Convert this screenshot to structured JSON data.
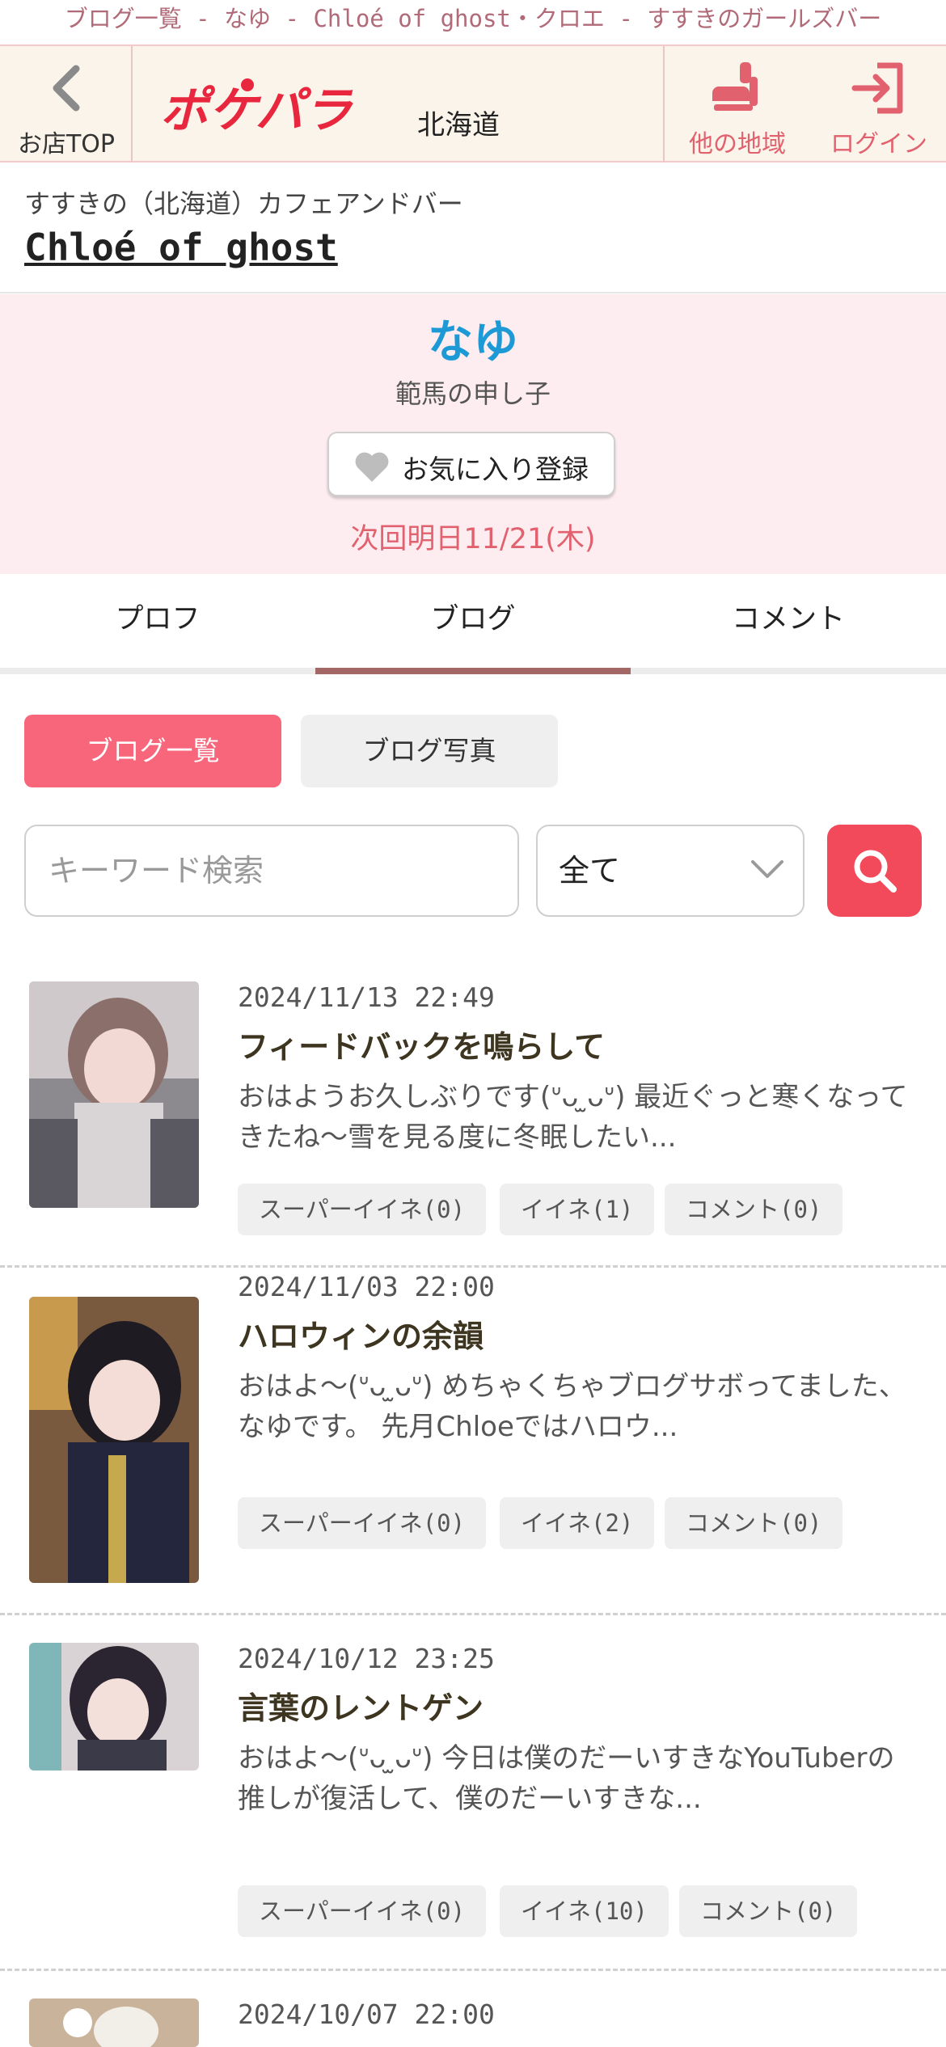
{
  "page": {
    "caption": "ブログ一覧 - なゆ - Chloé of ghost・クロエ - すすきのガールズバー"
  },
  "header": {
    "back_label": "お店TOP",
    "logo_text": "ポケパラ",
    "region": "北海道",
    "region_button_label": "他の地域",
    "login_label": "ログイン",
    "accent_color": "#e2616e"
  },
  "shop": {
    "subtitle": "すすきの（北海道）カフェアンドバー",
    "name": "Chloé of ghost"
  },
  "profile": {
    "name": "なゆ",
    "tagline": "範馬の申し子",
    "favorite_label": "お気に入り登録",
    "next_shift": "次回明日11/21(木)"
  },
  "tabs": [
    {
      "label": "プロフ",
      "active": false
    },
    {
      "label": "ブログ",
      "active": true
    },
    {
      "label": "コメント",
      "active": false
    }
  ],
  "blog_nav": {
    "list_label": "ブログ一覧",
    "photos_label": "ブログ写真"
  },
  "search": {
    "placeholder": "キーワード検索",
    "filter_value": "全て"
  },
  "posts": [
    {
      "date": "2024/11/13 22:49",
      "title": "フィードバックを鳴らして",
      "excerpt": "おはようお久しぶりです(ᐡᴗ ̫ᴗᐡ) 最近ぐっと寒くなってきたね〜雪を見る度に冬眠したい...",
      "super_likes": "スーパーイイネ(0)",
      "likes": "イイネ(1)",
      "comments": "コメント(0)"
    },
    {
      "date": "2024/11/03 22:00",
      "title": "ハロウィンの余韻",
      "excerpt": "おはよ〜(ᐡᴗ ̫ᴗᐡ) めちゃくちゃブログサボってました、なゆです。 先月Chloeではハロウ...",
      "super_likes": "スーパーイイネ(0)",
      "likes": "イイネ(2)",
      "comments": "コメント(0)"
    },
    {
      "date": "2024/10/12 23:25",
      "title": "言葉のレントゲン",
      "excerpt": "おはよ〜(ᐡᴗ ̫ᴗᐡ) 今日は僕のだーいすきなYouTuberの推しが復活して、僕のだーいすきな...",
      "super_likes": "スーパーイイネ(0)",
      "likes": "イイネ(10)",
      "comments": "コメント(0)"
    },
    {
      "date": "2024/10/07 22:00"
    }
  ]
}
